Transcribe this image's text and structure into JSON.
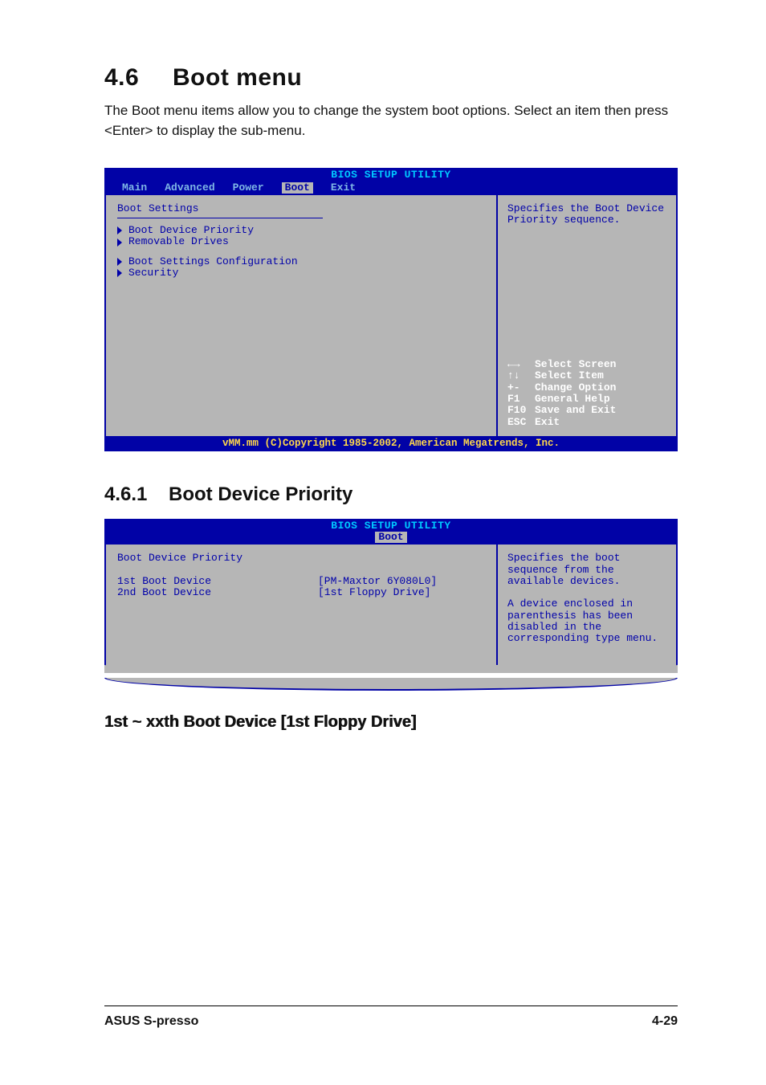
{
  "heading": {
    "num": "4.6",
    "title": "Boot menu"
  },
  "intro": "The Boot menu items allow you to change the system boot options. Select an item then press <Enter> to display the sub-menu.",
  "bios1": {
    "utility": "BIOS SETUP UTILITY",
    "tabs": [
      "Main",
      "Advanced",
      "Power",
      "Boot",
      "Exit"
    ],
    "active_tab": "Boot",
    "panel_title": "Boot Settings",
    "group1": [
      "Boot Device Priority",
      "Removable Drives"
    ],
    "group2": [
      "Boot Settings Configuration",
      "Security"
    ],
    "help": "Specifies the Boot Device Priority sequence.",
    "keys": [
      {
        "sym": "←→",
        "txt": "Select Screen"
      },
      {
        "sym": "↑↓",
        "txt": "Select Item"
      },
      {
        "sym": "+-",
        "txt": "Change Option"
      },
      {
        "sym": "F1",
        "txt": "General Help"
      },
      {
        "sym": "F10",
        "txt": "Save and Exit"
      },
      {
        "sym": "ESC",
        "txt": "Exit"
      }
    ],
    "footer": "vMM.mm (C)Copyright 1985-2002, American Megatrends, Inc."
  },
  "sub": {
    "num": "4.6.1",
    "title": "Boot Device Priority"
  },
  "bios2": {
    "utility": "BIOS SETUP UTILITY",
    "active_tab": "Boot",
    "panel_title": "Boot Device Priority",
    "rows": [
      {
        "k": "1st Boot Device",
        "v": "[PM-Maxtor 6Y080L0]"
      },
      {
        "k": "2nd Boot Device",
        "v": "[1st Floppy Drive]"
      }
    ],
    "help": "Specifies the boot sequence from the available devices.\n\nA device enclosed in parenthesis has been disabled in the corresponding type menu."
  },
  "item_heading": "1st ~ xxth Boot Device [1st Floppy Drive]",
  "footer": {
    "left": "ASUS S-presso",
    "right": "4-29"
  }
}
